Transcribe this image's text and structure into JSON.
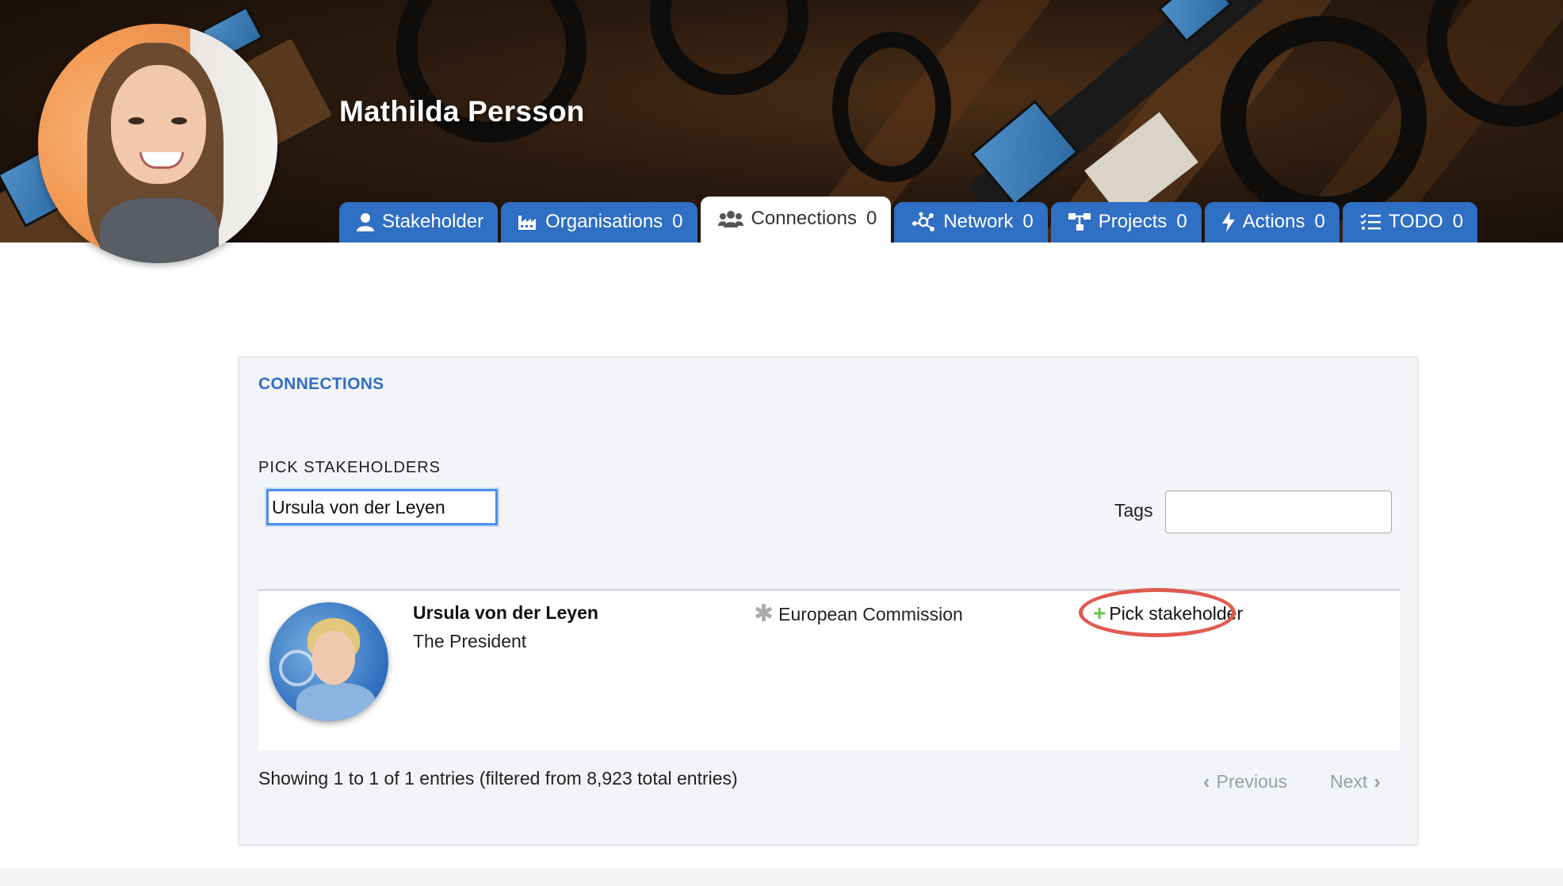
{
  "profile": {
    "name": "Mathilda Persson"
  },
  "tabs": [
    {
      "label": "Stakeholder",
      "count": "",
      "icon": "user-icon"
    },
    {
      "label": "Organisations",
      "count": "0",
      "icon": "industry-icon"
    },
    {
      "label": "Connections",
      "count": "0",
      "icon": "users-icon",
      "active": true
    },
    {
      "label": "Network",
      "count": "0",
      "icon": "network-icon"
    },
    {
      "label": "Projects",
      "count": "0",
      "icon": "sitemap-icon"
    },
    {
      "label": "Actions",
      "count": "0",
      "icon": "bolt-icon"
    },
    {
      "label": "TODO",
      "count": "0",
      "icon": "checklist-icon"
    }
  ],
  "panel": {
    "title": "CONNECTIONS",
    "pick_label": "PICK STAKEHOLDERS",
    "search_value": "Ursula von der Leyen",
    "tags_label": "Tags",
    "tags_value": ""
  },
  "results": [
    {
      "name": "Ursula von der Leyen",
      "role": "The President",
      "organisation": "European Commission",
      "action": "Pick stakeholder"
    }
  ],
  "footer": {
    "showing": "Showing 1 to 1 of 1 entries (filtered from 8,923 total entries)",
    "previous": "Previous",
    "next": "Next"
  },
  "colors": {
    "accent": "#2f6fc4",
    "highlight_ring": "#e05a4f",
    "plus": "#6cc04a"
  }
}
